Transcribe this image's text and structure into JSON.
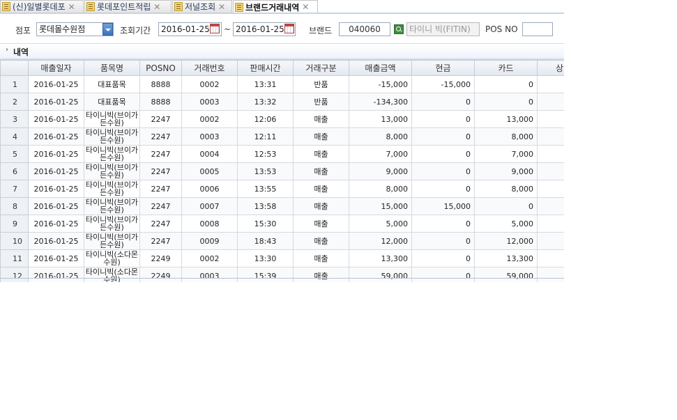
{
  "tabs": [
    {
      "label": "(신)일별롯데포",
      "active": false,
      "icon": "folder-doc-icon"
    },
    {
      "label": "롯데포인트적립",
      "active": false,
      "icon": "folder-doc-icon"
    },
    {
      "label": "저널조회",
      "active": false,
      "icon": "folder-doc-icon"
    },
    {
      "label": "브랜드거래내역",
      "active": true,
      "icon": "folder-doc-icon"
    }
  ],
  "filter": {
    "store_label": "점포",
    "store_value": "롯데몰수원점",
    "period_label": "조회기간",
    "date_from": "2016-01-25",
    "separator": "~",
    "date_to": "2016-01-25",
    "brand_label": "브랜드",
    "brand_code": "040060",
    "brand_name": "타이니 빅(FITIN)",
    "posno_label": "POS NO",
    "posno_value": ""
  },
  "section": {
    "title": "내역",
    "chevron": "›"
  },
  "grid": {
    "columns": [
      "",
      "매출일자",
      "품목명",
      "POSNO",
      "거래번호",
      "판매시간",
      "거래구분",
      "매출금액",
      "현금",
      "카드",
      "상"
    ],
    "rows": [
      {
        "n": "1",
        "date": "2016-01-25",
        "item": "대표품목",
        "pos": "8888",
        "tx": "0002",
        "time": "13:31",
        "type": "반품",
        "amount": "-15,000",
        "cash": "-15,000",
        "card": "0"
      },
      {
        "n": "2",
        "date": "2016-01-25",
        "item": "대표품목",
        "pos": "8888",
        "tx": "0003",
        "time": "13:32",
        "type": "반품",
        "amount": "-134,300",
        "cash": "0",
        "card": "0"
      },
      {
        "n": "3",
        "date": "2016-01-25",
        "item": "타이니빅(브이가든수원)",
        "pos": "2247",
        "tx": "0002",
        "time": "12:06",
        "type": "매출",
        "amount": "13,000",
        "cash": "0",
        "card": "13,000"
      },
      {
        "n": "4",
        "date": "2016-01-25",
        "item": "타이니빅(브이가든수원)",
        "pos": "2247",
        "tx": "0003",
        "time": "12:11",
        "type": "매출",
        "amount": "8,000",
        "cash": "0",
        "card": "8,000"
      },
      {
        "n": "5",
        "date": "2016-01-25",
        "item": "타이니빅(브이가든수원)",
        "pos": "2247",
        "tx": "0004",
        "time": "12:53",
        "type": "매출",
        "amount": "7,000",
        "cash": "0",
        "card": "7,000"
      },
      {
        "n": "6",
        "date": "2016-01-25",
        "item": "타이니빅(브이가든수원)",
        "pos": "2247",
        "tx": "0005",
        "time": "13:53",
        "type": "매출",
        "amount": "9,000",
        "cash": "0",
        "card": "9,000"
      },
      {
        "n": "7",
        "date": "2016-01-25",
        "item": "타이니빅(브이가든수원)",
        "pos": "2247",
        "tx": "0006",
        "time": "13:55",
        "type": "매출",
        "amount": "8,000",
        "cash": "0",
        "card": "8,000"
      },
      {
        "n": "8",
        "date": "2016-01-25",
        "item": "타이니빅(브이가든수원)",
        "pos": "2247",
        "tx": "0007",
        "time": "13:58",
        "type": "매출",
        "amount": "15,000",
        "cash": "15,000",
        "card": "0"
      },
      {
        "n": "9",
        "date": "2016-01-25",
        "item": "타이니빅(브이가든수원)",
        "pos": "2247",
        "tx": "0008",
        "time": "15:30",
        "type": "매출",
        "amount": "5,000",
        "cash": "0",
        "card": "5,000"
      },
      {
        "n": "10",
        "date": "2016-01-25",
        "item": "타이니빅(브이가든수원)",
        "pos": "2247",
        "tx": "0009",
        "time": "18:43",
        "type": "매출",
        "amount": "12,000",
        "cash": "0",
        "card": "12,000"
      },
      {
        "n": "11",
        "date": "2016-01-25",
        "item": "타이니빅(소다몬수원)",
        "pos": "2249",
        "tx": "0002",
        "time": "13:30",
        "type": "매출",
        "amount": "13,300",
        "cash": "0",
        "card": "13,300"
      },
      {
        "n": "12",
        "date": "2016-01-25",
        "item": "타이니빅(소다몬수원)",
        "pos": "2249",
        "tx": "0003",
        "time": "15:39",
        "type": "매출",
        "amount": "59,000",
        "cash": "0",
        "card": "59,000"
      }
    ]
  }
}
